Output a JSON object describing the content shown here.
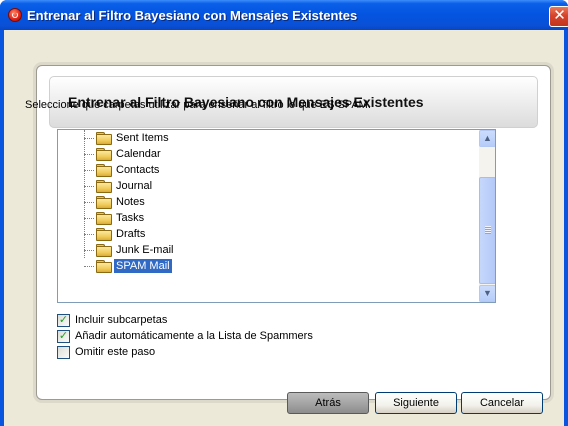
{
  "window": {
    "title": "Entrenar al Filtro Bayesiano con Mensajes Existentes",
    "close_glyph": "✕"
  },
  "panel": {
    "title": "Entrenar al Filtro Bayesiano con Mensajes Existentes",
    "instruction": "Seleccione qué carpetas utilizar para enseñar al filtro lo que ES SPAM."
  },
  "tree": {
    "items": [
      {
        "label": "Sent Items",
        "icon": "folder-icon",
        "selected": false
      },
      {
        "label": "Calendar",
        "icon": "folder-icon",
        "selected": false
      },
      {
        "label": "Contacts",
        "icon": "folder-icon",
        "selected": false
      },
      {
        "label": "Journal",
        "icon": "folder-icon",
        "selected": false
      },
      {
        "label": "Notes",
        "icon": "folder-icon",
        "selected": false
      },
      {
        "label": "Tasks",
        "icon": "folder-icon",
        "selected": false
      },
      {
        "label": "Drafts",
        "icon": "folder-icon",
        "selected": false
      },
      {
        "label": "Junk E-mail",
        "icon": "folder-icon",
        "selected": false
      },
      {
        "label": "SPAM Mail",
        "icon": "folder-icon",
        "selected": true
      }
    ],
    "scroll_up_glyph": "▲",
    "scroll_down_glyph": "▼"
  },
  "options": [
    {
      "label": "Incluir subcarpetas",
      "checked": true
    },
    {
      "label": "Añadir automáticamente a la Lista de Spammers",
      "checked": true
    },
    {
      "label": "Omitir este paso",
      "checked": false
    }
  ],
  "check_glyph": "✓",
  "buttons": {
    "back": "Atrás",
    "next": "Siguiente",
    "cancel": "Cancelar"
  },
  "colors": {
    "titlebar": "#0454e0",
    "selection": "#316ac5",
    "client_bg": "#ece9d8"
  }
}
